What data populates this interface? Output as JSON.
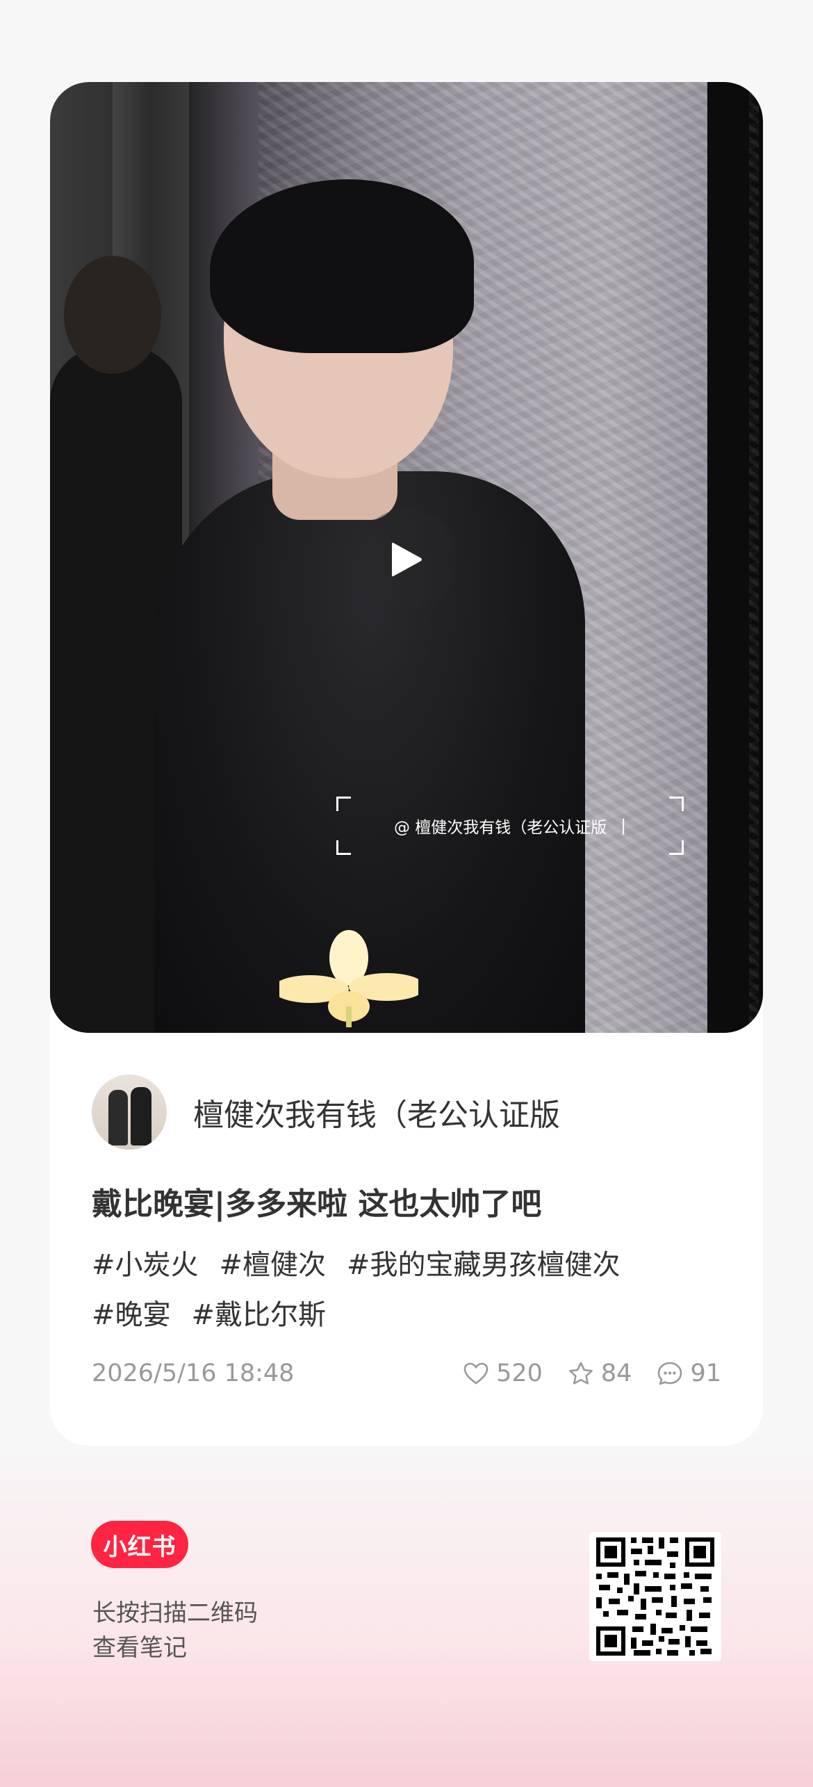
{
  "video": {
    "watermark": "@ 檀健次我有钱（老公认证版",
    "watermark_cursor": "|"
  },
  "author": {
    "name": "檀健次我有钱（老公认证版"
  },
  "note": {
    "title": "戴比晚宴|多多来啦 这也太帅了吧",
    "tags": [
      "#小炭火",
      "#檀健次",
      "#我的宝藏男孩檀健次",
      "#晚宴",
      "#戴比尔斯"
    ],
    "date": "2026/5/16 18:48",
    "likes": "520",
    "favorites": "84",
    "comments": "91"
  },
  "footer": {
    "logo": "小红书",
    "line1": "长按扫描二维码",
    "line2": "查看笔记"
  },
  "colors": {
    "brand": "#ff2442",
    "meta_text": "#999999"
  },
  "icons": [
    "play-icon",
    "heart-icon",
    "star-icon",
    "comment-icon",
    "qr-code"
  ]
}
